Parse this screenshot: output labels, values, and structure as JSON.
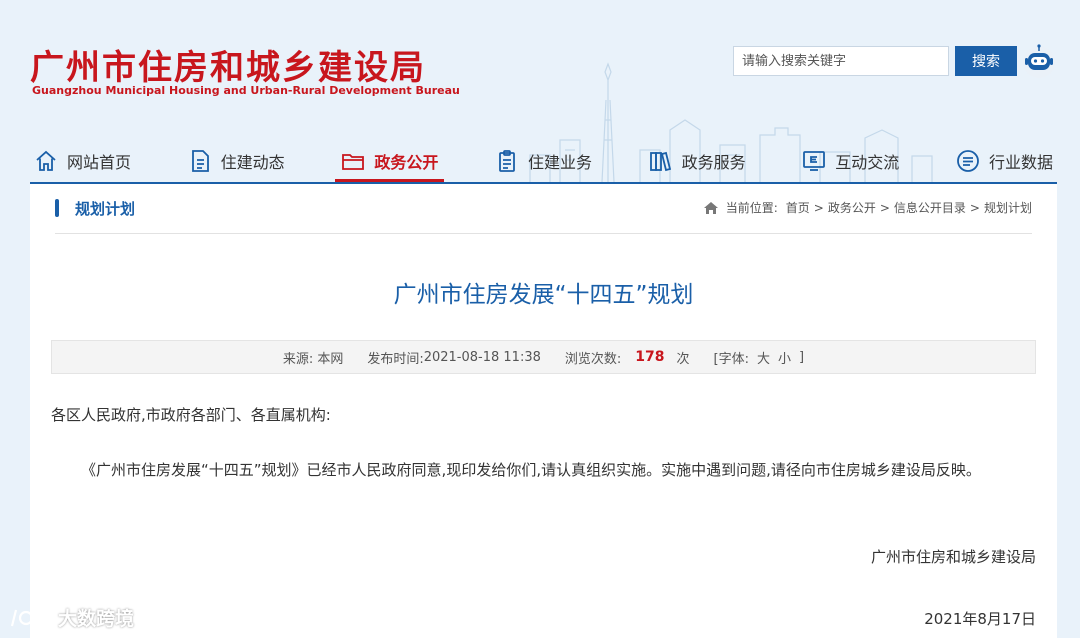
{
  "header": {
    "title_cn": "广州市住房和城乡建设局",
    "title_en": "Guangzhou Municipal Housing and Urban-Rural Development Bureau",
    "search_placeholder": "请输入搜索关键字",
    "search_button": "搜索"
  },
  "nav": [
    {
      "label": "网站首页",
      "icon": "home-icon"
    },
    {
      "label": "住建动态",
      "icon": "document-icon"
    },
    {
      "label": "政务公开",
      "icon": "folder-icon",
      "active": true
    },
    {
      "label": "住建业务",
      "icon": "clipboard-icon"
    },
    {
      "label": "政务服务",
      "icon": "books-icon"
    },
    {
      "label": "互动交流",
      "icon": "chat-e-icon"
    },
    {
      "label": "行业数据",
      "icon": "message-icon"
    }
  ],
  "section": {
    "title": "规划计划",
    "breadcrumb_prefix": "当前位置:",
    "breadcrumb": [
      "首页",
      "政务公开",
      "信息公开目录",
      "规划计划"
    ],
    "breadcrumb_sep": ">"
  },
  "article": {
    "title": "广州市住房发展“十四五”规划",
    "meta": {
      "source_label": "来源:",
      "source": "本网",
      "time_label": "发布时间:",
      "time": "2021-08-18 11:38",
      "views_label": "浏览次数:",
      "views": "178",
      "views_unit": "次",
      "font_label": "[字体:",
      "font_large": "大",
      "font_small": "小",
      "font_close": "]"
    },
    "greeting": "各区人民政府,市政府各部门、各直属机构:",
    "body": "《广州市住房发展“十四五”规划》已经市人民政府同意,现印发给你们,请认真组织实施。实施中遇到问题,请径向市住房城乡建设局反映。",
    "signature": "广州市住房和城乡建设局",
    "date": "2021年8月17日"
  },
  "watermark": "大数跨境",
  "colors": {
    "brand_red": "#c8161d",
    "brand_blue": "#1a5fa8",
    "page_bg": "#e9f2fa"
  }
}
